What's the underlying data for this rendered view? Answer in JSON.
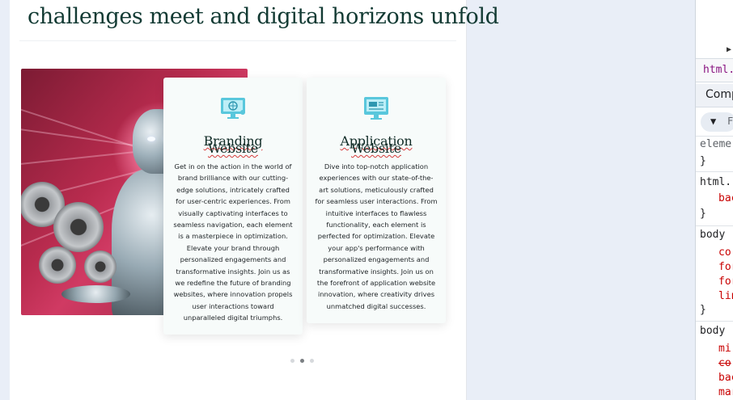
{
  "page": {
    "headline": "challenges meet and digital horizons unfold"
  },
  "cards": [
    {
      "icon": "branding-monitor-icon",
      "title_line1": "Branding",
      "title_line2": "Website",
      "body": "Get in on the action in the world of brand brilliance with our cutting-edge solutions, intricately crafted for user-centric experiences. From visually captivating interfaces to seamless navigation, each element is a masterpiece in optimization. Elevate your brand through personalized engagements and transformative insights. Join us as we redefine the future of branding websites, where innovation propels user interactions toward unparalleled digital triumphs."
    },
    {
      "icon": "application-monitor-icon",
      "title_line1": "Application",
      "title_line2": "Website",
      "body": "Dive into top-notch application experiences with our state-of-the-art solutions, meticulously crafted for seamless user interactions. From intuitive interfaces to flawless functionality, each element is perfected for optimization. Elevate your app's performance with personalized engagements and transformative insights. Join us on the forefront of application website innovation, where creativity drives unmatched digital successes."
    }
  ],
  "carousel": {
    "dot_count": 3,
    "active_index": 1
  },
  "devtools": {
    "breadcrumb": "html..",
    "tab": "Comp",
    "filter_text": "F",
    "lines": {
      "l1": "eleme",
      "l2": "}",
      "l3": "html.",
      "l4": "bac",
      "l5": "}",
      "l6": "body",
      "l7": "co",
      "l8": "for",
      "l9": "for",
      "l10": "lin",
      "l11": "}",
      "l12": "body",
      "l13": "mi",
      "l14": "co",
      "l15": "bac",
      "l16": "mar"
    }
  },
  "colors": {
    "headline": "#123a33",
    "card_bg": "#f7fbfa",
    "icon": "#59c7dc",
    "squiggle": "#d43a3a",
    "devtools_selector": "#202124",
    "devtools_prop": "#c80000"
  }
}
